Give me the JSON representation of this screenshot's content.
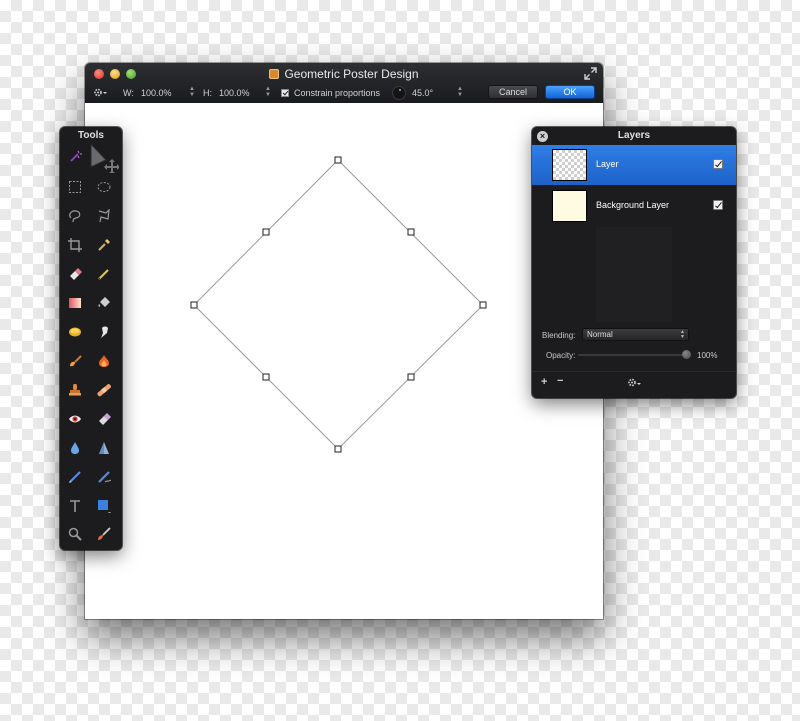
{
  "document": {
    "title": "Geometric Poster Design",
    "options": {
      "width_label": "W:",
      "width_value": "100.0%",
      "height_label": "H:",
      "height_value": "100.0%",
      "constrain_label": "Constrain proportions",
      "angle_value": "45.0°",
      "cancel_label": "Cancel",
      "ok_label": "OK"
    }
  },
  "tools_panel": {
    "title": "Tools",
    "tools": [
      "magic-wand-icon",
      "arrow-icon",
      "rect-select-icon",
      "ellipse-select-icon",
      "lasso-icon",
      "polygon-lasso-icon",
      "crop-icon",
      "eyedropper-icon",
      "eraser-icon",
      "pencil-icon",
      "gradient-icon",
      "paint-bucket-icon",
      "sponge-icon",
      "smudge-icon",
      "brush-icon",
      "burn-icon",
      "stamp-icon",
      "bandage-icon",
      "red-eye-icon",
      "eraser2-icon",
      "drop-icon",
      "sharpen-icon",
      "pen-icon",
      "pen-plus-icon",
      "text-icon",
      "shape-icon",
      "zoom-icon",
      "color-brush-icon"
    ]
  },
  "layers_panel": {
    "title": "Layers",
    "layers": [
      {
        "name": "Layer",
        "selected": true,
        "visible": true
      },
      {
        "name": "Background Layer",
        "selected": false,
        "visible": true
      }
    ],
    "blending_label": "Blending:",
    "blending_value": "Normal",
    "opacity_label": "Opacity:",
    "opacity_value": "100%",
    "opacity": 1.0
  },
  "colors": {
    "accent": "#2f7ee6",
    "panel_bg": "#1c1c1e",
    "titlebar": "#232428",
    "ok_button": "#1f78ee"
  }
}
